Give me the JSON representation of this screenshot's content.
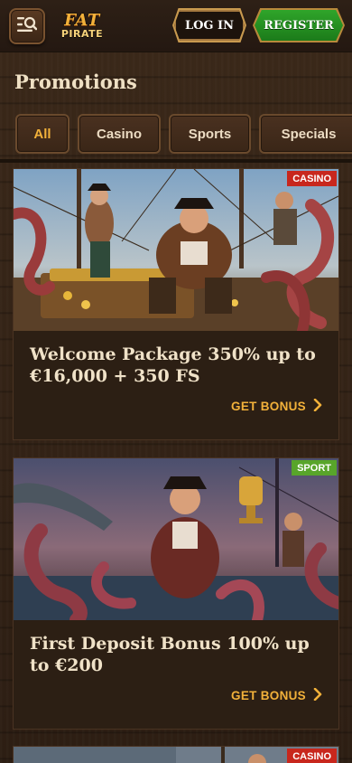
{
  "header": {
    "logo_top": "FAT",
    "logo_bottom": "PIRATE",
    "login_label": "LOG IN",
    "register_label": "REGISTER"
  },
  "page": {
    "title": "Promotions"
  },
  "tabs": [
    {
      "label": "All",
      "active": true
    },
    {
      "label": "Casino",
      "active": false
    },
    {
      "label": "Sports",
      "active": false
    },
    {
      "label": "Specials",
      "active": false
    }
  ],
  "promotions": [
    {
      "badge": "CASINO",
      "badge_color": "#c8271d",
      "title": "Welcome Package 350% up to €16,000 + 350 FS",
      "cta": "GET BONUS"
    },
    {
      "badge": "SPORT",
      "badge_color": "#58a52a",
      "title": "First Deposit Bonus 100% up to €200",
      "cta": "GET BONUS"
    },
    {
      "badge": "CASINO",
      "badge_color": "#c8271d",
      "title": "",
      "cta": ""
    }
  ],
  "icons": {
    "menu": "menu-search-icon",
    "cta_arrow": "chevron-right-icon"
  },
  "colors": {
    "accent": "#f2b13a",
    "register": "#2fa52a",
    "background": "#2a1c12"
  }
}
